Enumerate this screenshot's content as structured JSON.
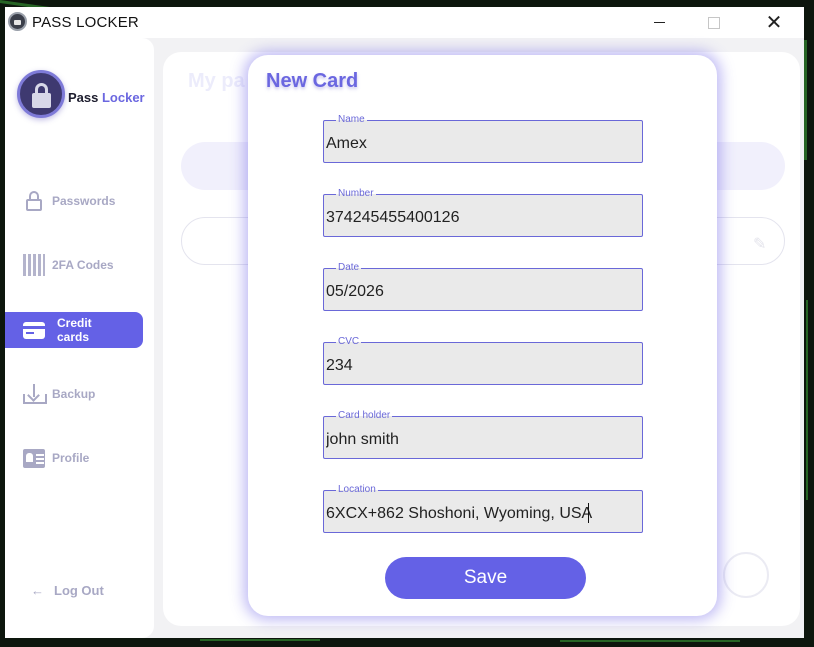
{
  "window": {
    "title": "PASS LOCKER",
    "controls": {
      "minimize": "minimize",
      "maximize": "maximize",
      "close": "✕"
    }
  },
  "sidebar": {
    "brand_part1": "Pass ",
    "brand_part2": "Locker",
    "items": [
      {
        "label": "Passwords",
        "icon": "lock-icon",
        "active": false
      },
      {
        "label": "2FA Codes",
        "icon": "qr-code-icon",
        "active": false
      },
      {
        "label": "Credit cards",
        "icon": "credit-card-icon",
        "active": true
      },
      {
        "label": "Backup",
        "icon": "download-icon",
        "active": false
      },
      {
        "label": "Profile",
        "icon": "id-card-icon",
        "active": false
      }
    ],
    "logout": {
      "label": "Log Out",
      "icon": "arrow-left-icon"
    }
  },
  "modal": {
    "title": "New Card",
    "fields": [
      {
        "legend": "Name",
        "value": "Amex"
      },
      {
        "legend": "Number",
        "value": "374245455400126"
      },
      {
        "legend": "Date",
        "value": "05/2026"
      },
      {
        "legend": "CVC",
        "value": "234"
      },
      {
        "legend": "Card holder",
        "value": "john smith"
      },
      {
        "legend": "Location",
        "value": "6XCX+862 Shoshoni, Wyoming, USA"
      }
    ],
    "save_label": "Save"
  },
  "colors": {
    "accent": "#6461e6",
    "nav_inactive": "#a8a8c4",
    "field_border": "#6a68d8",
    "field_bg": "#eaeaea"
  }
}
